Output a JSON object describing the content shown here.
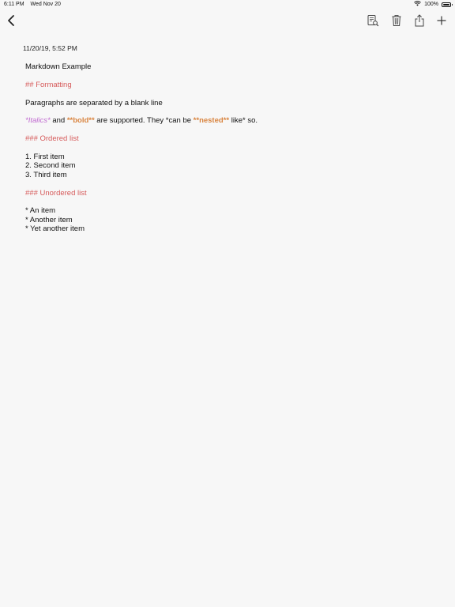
{
  "status_bar": {
    "time": "6:11 PM",
    "date": "Wed Nov 20",
    "battery_percent": "100%",
    "battery_level": 1.0
  },
  "toolbar": {
    "icons": [
      "chevron-left-icon",
      "markdown-preview-icon",
      "trash-icon",
      "share-icon",
      "plus-icon"
    ]
  },
  "note": {
    "timestamp": "11/20/19, 5:52 PM",
    "title": "Markdown Example",
    "heading_formatting": "## Formatting",
    "paragraph_line": "Paragraphs are separated by a blank line",
    "inline": {
      "italics": "*Italics*",
      "and": " and ",
      "bold": "**bold**",
      "mid": " are supported. They *can be ",
      "nested": "**nested**",
      "tail": " like* so."
    },
    "heading_ordered": "### Ordered list",
    "ordered_items": [
      "1. First item",
      "2. Second item",
      "3. Third item"
    ],
    "heading_unordered": "### Unordered list",
    "unordered_items": [
      "* An item",
      "* Another item",
      "* Yet another item"
    ]
  },
  "colors": {
    "heading": "#d65a5a",
    "italic": "#c06ad0",
    "bold": "#d9843f",
    "background": "#f7f7f7"
  }
}
